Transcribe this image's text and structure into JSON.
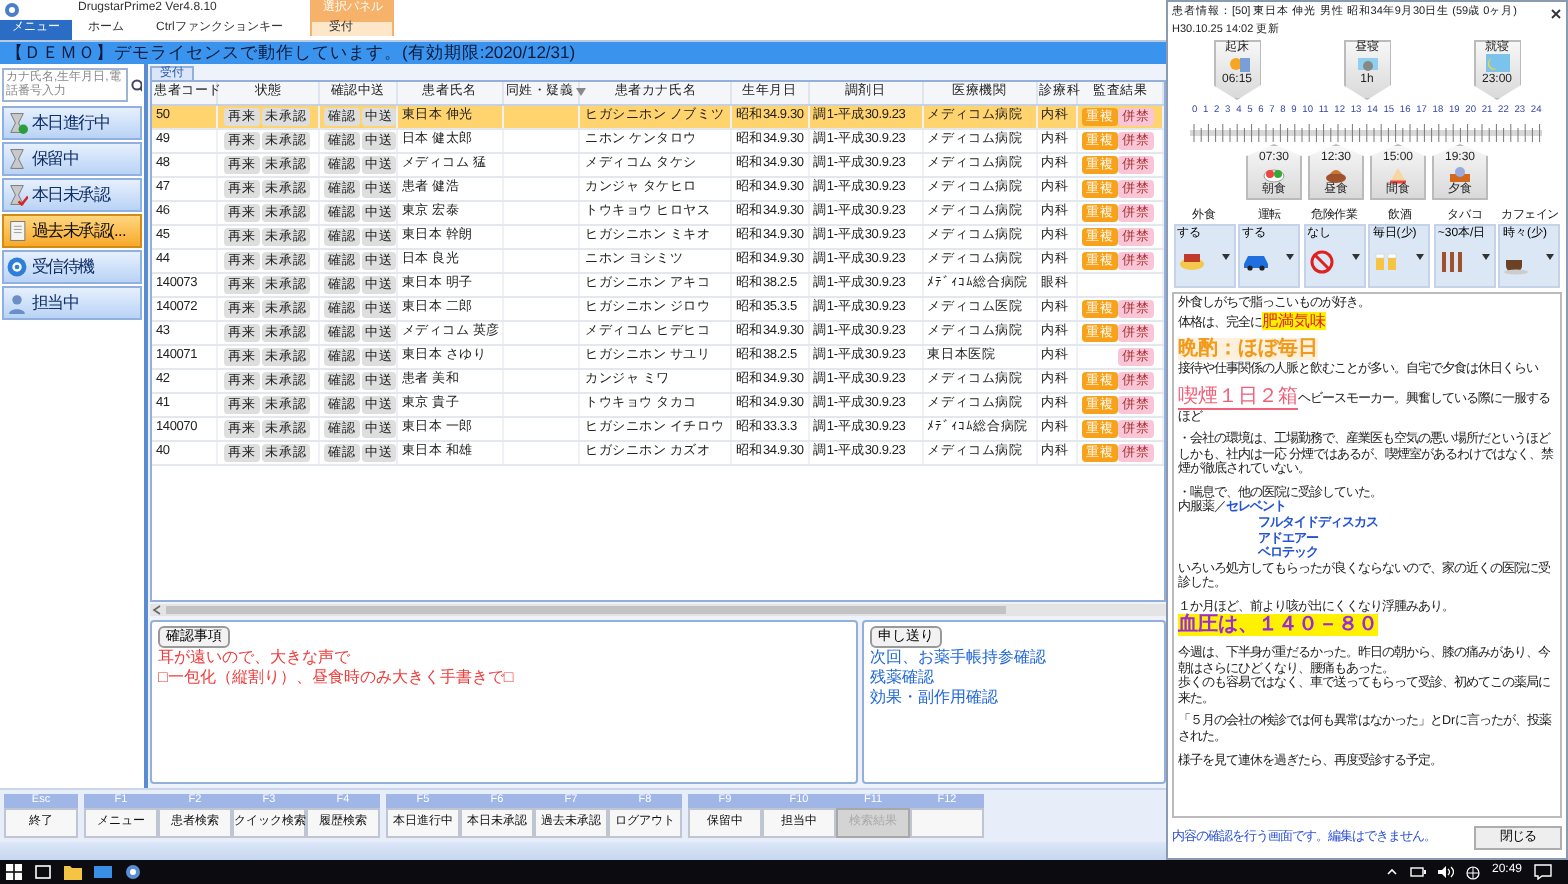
{
  "ribbon": {
    "title": "DrugstarPrime2 Ver4.8.10",
    "menu_button": "メニュー",
    "tabs": [
      {
        "label": "ホーム",
        "selected": false
      },
      {
        "label": "Ctrlファンクションキー",
        "selected": false
      },
      {
        "label": "受付",
        "selected": true,
        "contextual_group": "選択パネル"
      }
    ]
  },
  "banner": "【ＤＥＭＯ】デモライセンスで動作しています。(有効期限:2020/12/31)",
  "sidebar": {
    "search_placeholder": "カナ氏名,生年月日,電話番号入力",
    "items": [
      {
        "label": "本日進行中",
        "selected": false
      },
      {
        "label": "保留中",
        "selected": false
      },
      {
        "label": "本日未承認",
        "selected": false
      },
      {
        "label": "過去未承認(...",
        "selected": true
      },
      {
        "label": "受信待機",
        "selected": false
      },
      {
        "label": "担当中",
        "selected": false
      }
    ]
  },
  "main_tab": "受付",
  "table": {
    "columns": [
      "患者コード",
      "状態",
      "確認中送",
      "患者氏名",
      "同姓・疑義",
      "患者カナ氏名",
      "生年月日",
      "調剤日",
      "医療機関",
      "診療科",
      "監査結果"
    ],
    "rows": [
      {
        "code": "50",
        "status": [
          "再来",
          "未承認"
        ],
        "confirm": [
          "確認",
          "中送"
        ],
        "name": "東日本 伸光",
        "kana": "ヒガシニホン ノブミツ",
        "dob": "昭和34.9.30",
        "date": "調1-平成30.9.23",
        "clinic": "メディコム病院",
        "dept": "内科",
        "audit": [
          {
            "text": "重複",
            "kind": "duplicate"
          },
          {
            "text": "併禁",
            "kind": "contra"
          }
        ],
        "selected": true
      },
      {
        "code": "49",
        "status": [
          "再来",
          "未承認"
        ],
        "confirm": [
          "確認",
          "中送"
        ],
        "name": "日本 健太郎",
        "kana": "ニホン ケンタロウ",
        "dob": "昭和34.9.30",
        "date": "調1-平成30.9.23",
        "clinic": "メディコム病院",
        "dept": "内科",
        "audit": [
          {
            "text": "重複",
            "kind": "duplicate"
          },
          {
            "text": "併禁",
            "kind": "contra"
          }
        ],
        "selected": false
      },
      {
        "code": "48",
        "status": [
          "再来",
          "未承認"
        ],
        "confirm": [
          "確認",
          "中送"
        ],
        "name": "メディコム 猛",
        "kana": "メディコム タケシ",
        "dob": "昭和34.9.30",
        "date": "調1-平成30.9.23",
        "clinic": "メディコム病院",
        "dept": "内科",
        "audit": [
          {
            "text": "重複",
            "kind": "duplicate"
          },
          {
            "text": "併禁",
            "kind": "contra"
          }
        ],
        "selected": false
      },
      {
        "code": "47",
        "status": [
          "再来",
          "未承認"
        ],
        "confirm": [
          "確認",
          "中送"
        ],
        "name": "患者 健浩",
        "kana": "カンジャ タケヒロ",
        "dob": "昭和34.9.30",
        "date": "調1-平成30.9.23",
        "clinic": "メディコム病院",
        "dept": "内科",
        "audit": [
          {
            "text": "重複",
            "kind": "duplicate"
          },
          {
            "text": "併禁",
            "kind": "contra"
          }
        ],
        "selected": false
      },
      {
        "code": "46",
        "status": [
          "再来",
          "未承認"
        ],
        "confirm": [
          "確認",
          "中送"
        ],
        "name": "東京 宏泰",
        "kana": "トウキョウ ヒロヤス",
        "dob": "昭和34.9.30",
        "date": "調1-平成30.9.23",
        "clinic": "メディコム病院",
        "dept": "内科",
        "audit": [
          {
            "text": "重複",
            "kind": "duplicate"
          },
          {
            "text": "併禁",
            "kind": "contra"
          }
        ],
        "selected": false
      },
      {
        "code": "45",
        "status": [
          "再来",
          "未承認"
        ],
        "confirm": [
          "確認",
          "中送"
        ],
        "name": "東日本 幹朗",
        "kana": "ヒガシニホン ミキオ",
        "dob": "昭和34.9.30",
        "date": "調1-平成30.9.23",
        "clinic": "メディコム病院",
        "dept": "内科",
        "audit": [
          {
            "text": "重複",
            "kind": "duplicate"
          },
          {
            "text": "併禁",
            "kind": "contra"
          }
        ],
        "selected": false
      },
      {
        "code": "44",
        "status": [
          "再来",
          "未承認"
        ],
        "confirm": [
          "確認",
          "中送"
        ],
        "name": "日本 良光",
        "kana": "ニホン ヨシミツ",
        "dob": "昭和34.9.30",
        "date": "調1-平成30.9.23",
        "clinic": "メディコム病院",
        "dept": "内科",
        "audit": [
          {
            "text": "重複",
            "kind": "duplicate"
          },
          {
            "text": "併禁",
            "kind": "contra"
          }
        ],
        "selected": false
      },
      {
        "code": "140073",
        "status": [
          "再来",
          "未承認"
        ],
        "confirm": [
          "確認",
          "中送"
        ],
        "name": "東日本 明子",
        "kana": "ヒガシニホン アキコ",
        "dob": "昭和38.2.5",
        "date": "調1-平成30.9.23",
        "clinic": "ﾒﾃﾞｨｺﾑ総合病院",
        "dept": "眼科",
        "audit": [],
        "selected": false
      },
      {
        "code": "140072",
        "status": [
          "再来",
          "未承認"
        ],
        "confirm": [
          "確認",
          "中送"
        ],
        "name": "東日本 二郎",
        "kana": "ヒガシニホン ジロウ",
        "dob": "昭和35.3.5",
        "date": "調1-平成30.9.23",
        "clinic": "メディコム医院",
        "dept": "内科",
        "audit": [
          {
            "text": "重複",
            "kind": "duplicate"
          },
          {
            "text": "併禁",
            "kind": "contra"
          }
        ],
        "selected": false
      },
      {
        "code": "43",
        "status": [
          "再来",
          "未承認"
        ],
        "confirm": [
          "確認",
          "中送"
        ],
        "name": "メディコム 英彦",
        "kana": "メディコム ヒデヒコ",
        "dob": "昭和34.9.30",
        "date": "調1-平成30.9.23",
        "clinic": "メディコム病院",
        "dept": "内科",
        "audit": [
          {
            "text": "重複",
            "kind": "duplicate"
          },
          {
            "text": "併禁",
            "kind": "contra"
          }
        ],
        "selected": false
      },
      {
        "code": "140071",
        "status": [
          "再来",
          "未承認"
        ],
        "confirm": [
          "確認",
          "中送"
        ],
        "name": "東日本 さゆり",
        "kana": "ヒガシニホン サユリ",
        "dob": "昭和38.2.5",
        "date": "調1-平成30.9.23",
        "clinic": "東日本医院",
        "dept": "内科",
        "audit": [
          {
            "text": "併禁",
            "kind": "contra"
          }
        ],
        "selected": false
      },
      {
        "code": "42",
        "status": [
          "再来",
          "未承認"
        ],
        "confirm": [
          "確認",
          "中送"
        ],
        "name": "患者 美和",
        "kana": "カンジャ ミワ",
        "dob": "昭和34.9.30",
        "date": "調1-平成30.9.23",
        "clinic": "メディコム病院",
        "dept": "内科",
        "audit": [
          {
            "text": "重複",
            "kind": "duplicate"
          },
          {
            "text": "併禁",
            "kind": "contra"
          }
        ],
        "selected": false
      },
      {
        "code": "41",
        "status": [
          "再来",
          "未承認"
        ],
        "confirm": [
          "確認",
          "中送"
        ],
        "name": "東京 貴子",
        "kana": "トウキョウ タカコ",
        "dob": "昭和34.9.30",
        "date": "調1-平成30.9.23",
        "clinic": "メディコム病院",
        "dept": "内科",
        "audit": [
          {
            "text": "重複",
            "kind": "duplicate"
          },
          {
            "text": "併禁",
            "kind": "contra"
          }
        ],
        "selected": false
      },
      {
        "code": "140070",
        "status": [
          "再来",
          "未承認"
        ],
        "confirm": [
          "確認",
          "中送"
        ],
        "name": "東日本 一郎",
        "kana": "ヒガシニホン イチロウ",
        "dob": "昭和33.3.3",
        "date": "調1-平成30.9.23",
        "clinic": "ﾒﾃﾞｨｺﾑ総合病院",
        "dept": "内科",
        "audit": [
          {
            "text": "重複",
            "kind": "duplicate"
          },
          {
            "text": "併禁",
            "kind": "contra"
          }
        ],
        "selected": false
      },
      {
        "code": "40",
        "status": [
          "再来",
          "未承認"
        ],
        "confirm": [
          "確認",
          "中送"
        ],
        "name": "東日本 和雄",
        "kana": "ヒガシニホン カズオ",
        "dob": "昭和34.9.30",
        "date": "調1-平成30.9.23",
        "clinic": "メディコム病院",
        "dept": "内科",
        "audit": [
          {
            "text": "重複",
            "kind": "duplicate"
          },
          {
            "text": "併禁",
            "kind": "contra"
          }
        ],
        "selected": false
      }
    ]
  },
  "panels": [
    {
      "title": "確認事項",
      "kind": "caution",
      "lines": [
        "耳が遠いので、大きな声で",
        "□一包化（縦割り）、昼食時のみ大きく手書きで□"
      ]
    },
    {
      "title": "申し送り",
      "kind": "handover",
      "lines": [
        "次回、お薬手帳持参確認",
        "残薬確認",
        "効果・副作用確認"
      ]
    }
  ],
  "function_keys": [
    [
      {
        "key": "Esc",
        "label": "終了",
        "disabled": false
      }
    ],
    [
      {
        "key": "F1",
        "label": "メニュー",
        "disabled": false
      },
      {
        "key": "F2",
        "label": "患者検索",
        "disabled": false
      },
      {
        "key": "F3",
        "label": "クイック検索",
        "disabled": false
      },
      {
        "key": "F4",
        "label": "履歴検索",
        "disabled": false
      }
    ],
    [
      {
        "key": "F5",
        "label": "本日進行中",
        "disabled": false
      },
      {
        "key": "F6",
        "label": "本日未承認",
        "disabled": false
      },
      {
        "key": "F7",
        "label": "過去未承認",
        "disabled": false
      },
      {
        "key": "F8",
        "label": "ログアウト",
        "disabled": false
      }
    ],
    [
      {
        "key": "F9",
        "label": "保留中",
        "disabled": false
      },
      {
        "key": "F10",
        "label": "担当中",
        "disabled": false
      },
      {
        "key": "F11",
        "label": "検索結果",
        "disabled": true
      },
      {
        "key": "F12",
        "disabled": false
      }
    ]
  ],
  "dialog": {
    "title": "患者情報：[50] 東日本 伸光 男性 昭和34年9月30日生 (59歳 0ヶ月)",
    "updated": "H30.10.25 14:02 更新",
    "sleep": [
      {
        "label": "起床",
        "time": "06:15",
        "kind": "wake"
      },
      {
        "label": "昼寝",
        "time": "1h",
        "kind": "nap"
      },
      {
        "label": "就寝",
        "time": "23:00",
        "kind": "sleep"
      }
    ],
    "hours": [
      "0",
      "1",
      "2",
      "3",
      "4",
      "5",
      "6",
      "7",
      "8",
      "9",
      "10",
      "11",
      "12",
      "13",
      "14",
      "15",
      "16",
      "17",
      "18",
      "19",
      "20",
      "21",
      "22",
      "23",
      "24"
    ],
    "meals": [
      {
        "time": "07:30",
        "label": "朝食"
      },
      {
        "time": "12:30",
        "label": "昼食"
      },
      {
        "time": "15:00",
        "label": "間食"
      },
      {
        "time": "19:30",
        "label": "夕食"
      }
    ],
    "lifestyle": [
      {
        "label": "外食",
        "value": "する"
      },
      {
        "label": "運転",
        "value": "する"
      },
      {
        "label": "危険作業",
        "value": "なし"
      },
      {
        "label": "飲酒",
        "value": "毎日(少)"
      },
      {
        "label": "タバコ",
        "value": "~30本/日"
      },
      {
        "label": "カフェイン",
        "value": "時々(少)"
      }
    ],
    "notes": [
      {
        "spaced": false,
        "segments": [
          {
            "text": "外食しがちで脂っこいものが好き。",
            "kind": "plain"
          }
        ]
      },
      {
        "spaced": false,
        "segments": [
          {
            "text": "体格は、完全に",
            "kind": "plain"
          },
          {
            "text": "肥満気味",
            "kind": "marker"
          }
        ]
      },
      {
        "spaced": true,
        "segments": [
          {
            "text": "晩酌：ほぼ毎日",
            "kind": "heading_orange"
          }
        ]
      },
      {
        "spaced": false,
        "segments": [
          {
            "text": "接待や仕事関係の人脈と飲むことが多い。自宅で夕食は休日くらい",
            "kind": "plain"
          }
        ]
      },
      {
        "spaced": true,
        "segments": [
          {
            "text": "喫煙１日２箱",
            "kind": "heading_pink"
          },
          {
            "text": "ヘビースモーカー。興奮している際に一服するほど",
            "kind": "plain"
          }
        ]
      },
      {
        "spaced": true,
        "segments": [
          {
            "text": "・会社の環境は、工場勤務で、産業医も空気の悪い場所だというほど",
            "kind": "plain"
          }
        ]
      },
      {
        "spaced": false,
        "segments": [
          {
            "text": "しかも、社内は一応 分煙ではあるが、喫煙室があるわけではなく、禁煙が徹底されていない。",
            "kind": "plain"
          }
        ]
      },
      {
        "spaced": true,
        "segments": [
          {
            "text": "・喘息で、他の医院に受診していた。",
            "kind": "plain"
          }
        ]
      },
      {
        "spaced": false,
        "segments": [
          {
            "text": "内服薬／",
            "kind": "plain"
          },
          {
            "text": "セレベント",
            "kind": "drug"
          }
        ]
      },
      {
        "spaced": false,
        "segments": [
          {
            "text": "フルタイドディスカス",
            "kind": "drug"
          }
        ]
      },
      {
        "spaced": false,
        "segments": [
          {
            "text": "アドエアー",
            "kind": "drug"
          }
        ]
      },
      {
        "spaced": false,
        "segments": [
          {
            "text": "ベロテック",
            "kind": "drug"
          }
        ]
      },
      {
        "spaced": false,
        "segments": [
          {
            "text": "いろいろ処方してもらったが良くならないので、家の近くの医院に受診した。",
            "kind": "plain"
          }
        ]
      },
      {
        "spaced": true,
        "segments": [
          {
            "text": "１か月ほど、前より咳が出にくくなり浮腫みあり。",
            "kind": "plain"
          }
        ]
      },
      {
        "spaced": false,
        "segments": [
          {
            "text": "血圧は、１４０－８０",
            "kind": "heading_bp"
          }
        ]
      },
      {
        "spaced": true,
        "segments": [
          {
            "text": "今週は、下半身が重だるかった。昨日の朝から、膝の痛みがあり、今朝はさらにひどくなり、腰痛もあった。",
            "kind": "plain"
          }
        ]
      },
      {
        "spaced": false,
        "segments": [
          {
            "text": "歩くのも容易ではなく、車で送ってもらって受診、初めてこの薬局に来た。",
            "kind": "plain"
          }
        ]
      },
      {
        "spaced": true,
        "segments": [
          {
            "text": "「５月の会社の検診では何も異常はなかった」とDrに言ったが、投薬された。",
            "kind": "plain"
          }
        ]
      },
      {
        "spaced": true,
        "segments": [
          {
            "text": "様子を見て連休を過ぎたら、再度受診する予定。",
            "kind": "plain"
          }
        ]
      }
    ],
    "footer_note": "内容の確認を行う画面です。編集はできません。",
    "close_button": "閉じる"
  },
  "taskbar": {
    "clock": "20:49"
  }
}
